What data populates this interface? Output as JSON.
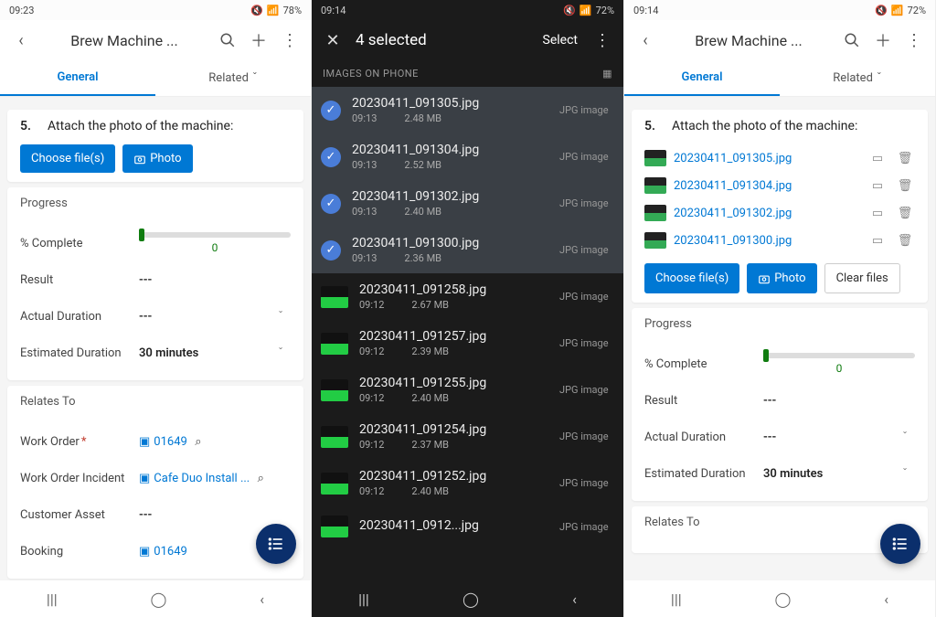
{
  "navbar": {
    "recent": "|||",
    "home": "◯",
    "back": "‹"
  },
  "p1": {
    "status": {
      "time": "09:23",
      "battery": "78%"
    },
    "title": "Brew Machine ...",
    "tabs": {
      "general": "General",
      "related": "Related"
    },
    "step": {
      "num": "5.",
      "text": "Attach the photo of the machine:"
    },
    "buttons": {
      "choose": "Choose file(s)",
      "photo": "Photo"
    },
    "progress": {
      "label": "Progress",
      "pct": {
        "lbl": "% Complete",
        "val": "0"
      },
      "result": {
        "lbl": "Result",
        "val": "---"
      },
      "actual": {
        "lbl": "Actual Duration",
        "val": "---"
      },
      "estimated": {
        "lbl": "Estimated Duration",
        "val": "30 minutes"
      }
    },
    "relates": {
      "label": "Relates To",
      "wo": {
        "lbl": "Work Order",
        "val": "01649"
      },
      "woi": {
        "lbl": "Work Order Incident",
        "val": "Cafe Duo Install ..."
      },
      "asset": {
        "lbl": "Customer Asset",
        "val": "---"
      },
      "booking": {
        "lbl": "Booking",
        "val": "01649"
      }
    }
  },
  "p2": {
    "status": {
      "time": "09:14",
      "battery": "72%"
    },
    "title": "4 selected",
    "select": "Select",
    "header": "IMAGES ON PHONE",
    "type": "JPG image",
    "items": [
      {
        "name": "20230411_091305.jpg",
        "time": "09:13",
        "size": "2.48 MB",
        "sel": true
      },
      {
        "name": "20230411_091304.jpg",
        "time": "09:13",
        "size": "2.52 MB",
        "sel": true
      },
      {
        "name": "20230411_091302.jpg",
        "time": "09:13",
        "size": "2.40 MB",
        "sel": true
      },
      {
        "name": "20230411_091300.jpg",
        "time": "09:13",
        "size": "2.36 MB",
        "sel": true
      },
      {
        "name": "20230411_091258.jpg",
        "time": "09:12",
        "size": "2.67 MB",
        "sel": false
      },
      {
        "name": "20230411_091257.jpg",
        "time": "09:12",
        "size": "2.39 MB",
        "sel": false
      },
      {
        "name": "20230411_091255.jpg",
        "time": "09:12",
        "size": "2.40 MB",
        "sel": false
      },
      {
        "name": "20230411_091254.jpg",
        "time": "09:12",
        "size": "2.37 MB",
        "sel": false
      },
      {
        "name": "20230411_091252.jpg",
        "time": "09:12",
        "size": "2.40 MB",
        "sel": false
      },
      {
        "name": "20230411_0912...jpg",
        "time": "",
        "size": "",
        "sel": false
      }
    ]
  },
  "p3": {
    "status": {
      "time": "09:14",
      "battery": "72%"
    },
    "title": "Brew Machine ...",
    "tabs": {
      "general": "General",
      "related": "Related"
    },
    "step": {
      "num": "5.",
      "text": "Attach the photo of the machine:"
    },
    "attachments": [
      "20230411_091305.jpg",
      "20230411_091304.jpg",
      "20230411_091302.jpg",
      "20230411_091300.jpg"
    ],
    "buttons": {
      "choose": "Choose file(s)",
      "photo": "Photo",
      "clear": "Clear files"
    },
    "progress": {
      "label": "Progress",
      "pct": {
        "lbl": "% Complete",
        "val": "0"
      },
      "result": {
        "lbl": "Result",
        "val": "---"
      },
      "actual": {
        "lbl": "Actual Duration",
        "val": "---"
      },
      "estimated": {
        "lbl": "Estimated Duration",
        "val": "30 minutes"
      }
    },
    "relates": {
      "label": "Relates To"
    }
  }
}
